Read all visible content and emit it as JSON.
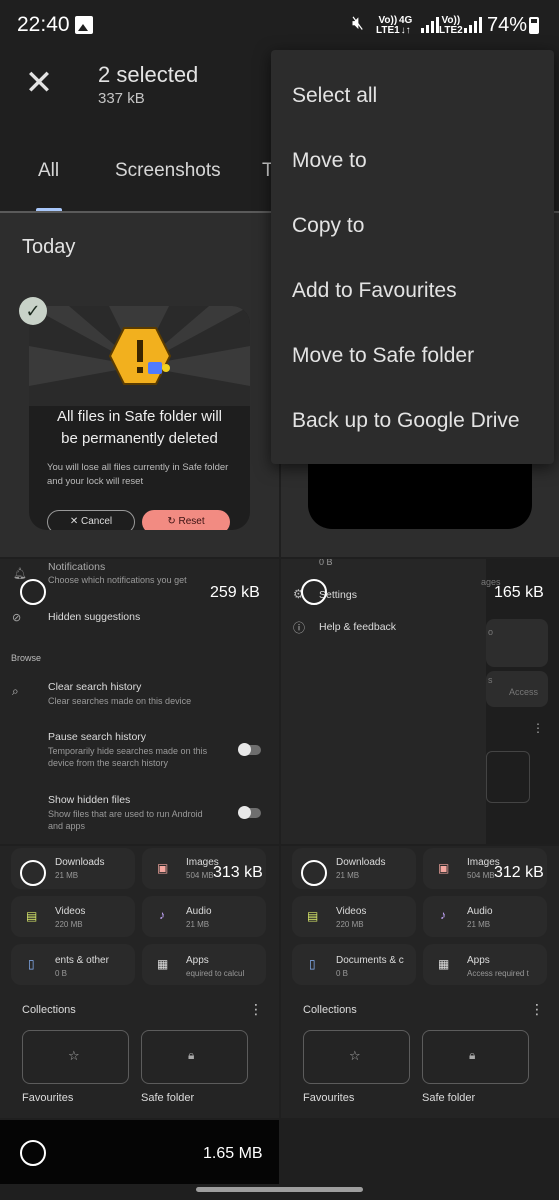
{
  "status_bar": {
    "time": "22:40",
    "sim1_top": "Vo))",
    "sim1_bottom": "LTE1",
    "net_type": "4G",
    "sim2_top": "Vo))",
    "sim2_bottom": "LTE2",
    "battery": "74%"
  },
  "app_bar": {
    "close_icon": "close-icon",
    "selection_title": "2 selected",
    "selection_size": "337 kB"
  },
  "tabs": [
    {
      "label": "All",
      "active": true
    },
    {
      "label": "Screenshots",
      "active": false
    },
    {
      "label": "T",
      "active": false
    }
  ],
  "section_title": "Today",
  "overflow_menu": {
    "items": [
      "Select all",
      "Move to",
      "Copy to",
      "Add to Favourites",
      "Move to Safe folder",
      "Back up to Google Drive"
    ]
  },
  "thumbnails": {
    "dialog": {
      "title_line1": "All files in Safe folder will",
      "title_line2": "be permanently deleted",
      "body": "You will lose all files currently in Safe folder and your lock will reset",
      "cancel": "Cancel",
      "reset": "Reset"
    },
    "settings": {
      "notifications": "Notifications",
      "notifications_sub": "Choose which notifications you get",
      "hidden_suggestions": "Hidden suggestions",
      "browse": "Browse",
      "clear_history": "Clear search history",
      "clear_history_sub": "Clear searches made on this device",
      "pause_history": "Pause search history",
      "pause_history_sub1": "Temporarily hide searches made on this",
      "pause_history_sub2": "device from the search history",
      "show_hidden": "Show hidden files",
      "show_hidden_sub1": "Show files that are used to run Android",
      "show_hidden_sub2": "and apps",
      "settings": "Settings",
      "help": "Help & feedback",
      "zero_b": "0 B",
      "ages": "ages",
      "o": "o",
      "s": "s",
      "access": "Access"
    },
    "categories_left": {
      "downloads": "Downloads",
      "downloads_size": "21 MB",
      "images": "Images",
      "images_size": "504 MB",
      "videos": "Videos",
      "videos_size": "220 MB",
      "audio": "Audio",
      "audio_size": "21 MB",
      "documents": "ents & other",
      "documents_size": "0 B",
      "apps": "Apps",
      "apps_sub": "equired to calcul",
      "collections": "Collections",
      "favourites": "Favourites",
      "safe_folder": "Safe folder"
    },
    "categories_right": {
      "downloads": "Downloads",
      "downloads_size": "21 MB",
      "images": "Images",
      "images_size": "504 MB",
      "videos": "Videos",
      "videos_size": "220 MB",
      "audio": "Audio",
      "audio_size": "21 MB",
      "documents": "Documents & c",
      "documents_size": "0 B",
      "apps": "Apps",
      "apps_sub": "Access required t",
      "collections": "Collections",
      "favourites": "Favourites",
      "safe_folder": "Safe folder"
    },
    "sizes": {
      "settings_left": "259 kB",
      "settings_right": "165 kB",
      "cats_left": "313 kB",
      "cats_right": "312 kB",
      "bottom_left": "1.65 MB"
    }
  }
}
